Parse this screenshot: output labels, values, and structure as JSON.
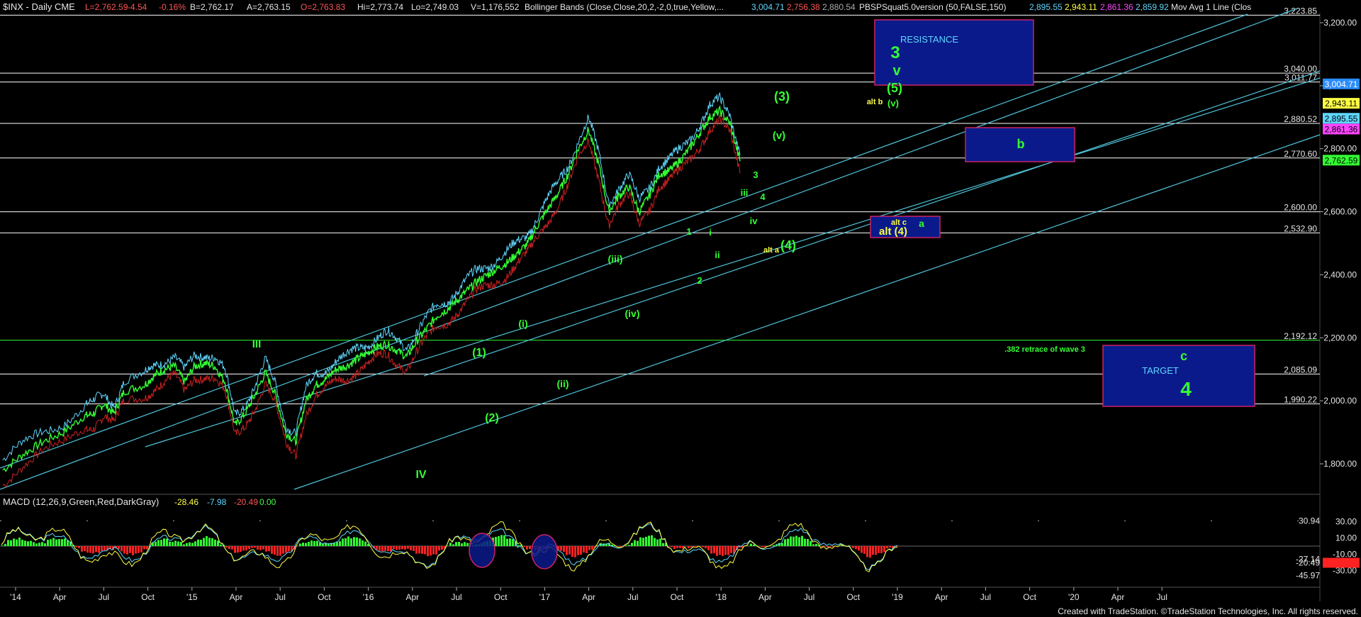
{
  "header": {
    "symbol": "$INX - Daily  CME",
    "fields": [
      {
        "text": "L=2,762.59",
        "color": "#ff5555"
      },
      {
        "text": "-4.54",
        "color": "#ff5555"
      },
      {
        "text": "-0.16%",
        "color": "#ff5555"
      },
      {
        "text": "B=2,762.17",
        "color": "#e6e6e6"
      },
      {
        "text": "A=2,763.15",
        "color": "#e6e6e6"
      },
      {
        "text": "O=2,763.83",
        "color": "#ff5555"
      },
      {
        "text": "Hi=2,773.74",
        "color": "#e6e6e6"
      },
      {
        "text": "Lo=2,749.03",
        "color": "#e6e6e6"
      },
      {
        "text": "V=1,176,552",
        "color": "#e6e6e6"
      },
      {
        "text": "Bollinger Bands (Close,Close,20,2,-2,0,true,Yellow,...",
        "color": "#e6e6e6"
      },
      {
        "text": "3,004.71",
        "color": "#5fd7ff"
      },
      {
        "text": "2,756.38",
        "color": "#ff5555"
      },
      {
        "text": "2,880.54",
        "color": "#aaaaaa"
      },
      {
        "text": "PBSPSquat5.0version (50,FALSE,150)",
        "color": "#e6e6e6"
      },
      {
        "text": "2,895.55",
        "color": "#5fd7ff"
      },
      {
        "text": "2,943.11",
        "color": "#ffff44"
      },
      {
        "text": "2,861.36",
        "color": "#ff44ff"
      },
      {
        "text": "2,859.92",
        "color": "#5fd7ff"
      },
      {
        "text": "Mov Avg 1 Line (Clos",
        "color": "#e6e6e6"
      }
    ]
  },
  "macd_header": {
    "label": "MACD (12,26,9,Green,Red,DarkGray)",
    "fields": [
      {
        "text": "-28.46",
        "color": "#ffff44"
      },
      {
        "text": "-7.98",
        "color": "#5fd7ff"
      },
      {
        "text": "-20.49",
        "color": "#ff5555"
      },
      {
        "text": "0.00",
        "color": "#44ff44"
      }
    ]
  },
  "footer": "Created with TradeStation. ©TradeStation Technologies, Inc. All rights reserved.",
  "colors": {
    "price": "#33ff33",
    "upper_band": "#5fd7ff",
    "lower_band": "#cc2222",
    "trend": "#4fc3d9",
    "box_fill": "#0a1a8a",
    "box_border": "#cc2266",
    "wave": "#33ff33",
    "alt": "#ffff44"
  },
  "chart_data": {
    "type": "line",
    "title": "$INX - Daily",
    "price_axis": {
      "min": 1650,
      "max": 3240,
      "ticks": [
        1800,
        2000,
        2200,
        2400,
        2600,
        2800,
        3000,
        3200
      ],
      "tick_labels": [
        "1,800.00",
        "2,000.00",
        "2,200.00",
        "2,400.00",
        "2,600.00",
        "2,800.00",
        "3,000.00",
        "3,200.00"
      ]
    },
    "x_axis": {
      "labels": [
        "'14",
        "Apr",
        "Jul",
        "Oct",
        "'15",
        "Apr",
        "Jul",
        "Oct",
        "'16",
        "Apr",
        "Jul",
        "Oct",
        "'17",
        "Apr",
        "Jul",
        "Oct",
        "'18",
        "Apr",
        "Jul",
        "Oct",
        "'19",
        "Apr",
        "Jul",
        "Oct",
        "'20",
        "Apr",
        "Jul"
      ]
    },
    "price_path": [
      [
        0,
        1780
      ],
      [
        2,
        1830
      ],
      [
        4,
        1870
      ],
      [
        6,
        1900
      ],
      [
        8,
        1950
      ],
      [
        9,
        1960
      ],
      [
        10,
        1990
      ],
      [
        11,
        1960
      ],
      [
        12,
        2030
      ],
      [
        14,
        2050
      ],
      [
        15,
        2080
      ],
      [
        16,
        2100
      ],
      [
        17,
        2110
      ],
      [
        18,
        2060
      ],
      [
        19,
        2110
      ],
      [
        20,
        2120
      ],
      [
        21,
        2110
      ],
      [
        22,
        2060
      ],
      [
        23,
        1920
      ],
      [
        24,
        1960
      ],
      [
        25,
        2020
      ],
      [
        26,
        2090
      ],
      [
        27,
        2020
      ],
      [
        28,
        1900
      ],
      [
        29,
        1870
      ],
      [
        30,
        2000
      ],
      [
        31,
        2050
      ],
      [
        32,
        2070
      ],
      [
        33,
        2100
      ],
      [
        34,
        2110
      ],
      [
        35,
        2130
      ],
      [
        36,
        2150
      ],
      [
        37,
        2170
      ],
      [
        38,
        2180
      ],
      [
        39,
        2160
      ],
      [
        40,
        2140
      ],
      [
        41,
        2190
      ],
      [
        42,
        2230
      ],
      [
        43,
        2270
      ],
      [
        44,
        2290
      ],
      [
        45,
        2320
      ],
      [
        46,
        2350
      ],
      [
        47,
        2380
      ],
      [
        48,
        2400
      ],
      [
        49,
        2420
      ],
      [
        50,
        2440
      ],
      [
        51,
        2470
      ],
      [
        52,
        2500
      ],
      [
        53,
        2560
      ],
      [
        54,
        2610
      ],
      [
        55,
        2660
      ],
      [
        56,
        2720
      ],
      [
        57,
        2800
      ],
      [
        58,
        2860
      ],
      [
        59,
        2750
      ],
      [
        60,
        2600
      ],
      [
        61,
        2650
      ],
      [
        62,
        2680
      ],
      [
        63,
        2600
      ],
      [
        64,
        2650
      ],
      [
        65,
        2720
      ],
      [
        66,
        2730
      ],
      [
        67,
        2760
      ],
      [
        68,
        2800
      ],
      [
        69,
        2850
      ],
      [
        70,
        2900
      ],
      [
        71,
        2920
      ],
      [
        72,
        2880
      ],
      [
        73,
        2760
      ]
    ],
    "price_path_note": "x in index units (0 = start of '14 = 19.5 per quarter column); y in index points",
    "horizontal_levels": [
      {
        "value": 3223.85,
        "label": "3,223.85",
        "color": "#ffffff"
      },
      {
        "value": 3040.0,
        "label": "3,040.00",
        "color": "#ffffff"
      },
      {
        "value": 3011.77,
        "label": "3,011.77",
        "color": "#ffffff"
      },
      {
        "value": 2880.52,
        "label": "2,880.52",
        "color": "#ffffff"
      },
      {
        "value": 2770.6,
        "label": "2,770.60",
        "color": "#ffffff"
      },
      {
        "value": 2600.0,
        "label": "2,600.00",
        "color": "#ffffff"
      },
      {
        "value": 2532.9,
        "label": "2,532.90",
        "color": "#ffffff"
      },
      {
        "value": 2192.12,
        "label": "2,192.12",
        "color": "#33ff33"
      },
      {
        "value": 2085.09,
        "label": "2,085.09",
        "color": "#ffffff"
      },
      {
        "value": 1990.22,
        "label": "1,990.22",
        "color": "#ffffff"
      }
    ],
    "right_badges": [
      {
        "value": 3004.71,
        "label": "3,004.71",
        "bg": "#2a8cff",
        "fg": "#ffffff"
      },
      {
        "value": 2943.11,
        "label": "2,943.11",
        "bg": "#ffff44",
        "fg": "#000000"
      },
      {
        "value": 2895.55,
        "label": "2,895.55",
        "bg": "#5fd7ff",
        "fg": "#000000"
      },
      {
        "value": 2861.36,
        "label": "2,861.36",
        "bg": "#ff44ff",
        "fg": "#000000"
      },
      {
        "value": 2762.59,
        "label": "2,762.59",
        "bg": "#33ff33",
        "fg": "#000000"
      }
    ],
    "macd_axis": {
      "ticks": [
        30,
        10,
        -10,
        -30
      ],
      "tick_labels": [
        "30.00",
        "10.00",
        "-10.00",
        "-30.00"
      ],
      "markers": [
        {
          "label": "30.94"
        },
        {
          "label": "-27.14"
        },
        {
          "label": "-20.49"
        },
        {
          "label": "-45.97"
        }
      ]
    },
    "annotations": {
      "boxes": [
        {
          "name": "resistance-box",
          "label": "RESISTANCE",
          "label_color": "#5fd7ff"
        },
        {
          "name": "b-box",
          "label": "b",
          "label_color": "#33ff33"
        },
        {
          "name": "a-box",
          "label": "a",
          "label_color": "#33ff33"
        },
        {
          "name": "target-box",
          "label": "TARGET",
          "label_color": "#5fd7ff"
        }
      ],
      "wave_labels": [
        {
          "text": "III",
          "color": "#33ff33"
        },
        {
          "text": "IV",
          "color": "#33ff33"
        },
        {
          "text": "(1)",
          "color": "#33ff33"
        },
        {
          "text": "(2)",
          "color": "#33ff33"
        },
        {
          "text": "(i)",
          "color": "#33ff33"
        },
        {
          "text": "(ii)",
          "color": "#33ff33"
        },
        {
          "text": "(iii)",
          "color": "#33ff33"
        },
        {
          "text": "(iv)",
          "color": "#33ff33"
        },
        {
          "text": "1",
          "color": "#33ff33"
        },
        {
          "text": "2",
          "color": "#33ff33"
        },
        {
          "text": "i",
          "color": "#33ff33"
        },
        {
          "text": "ii",
          "color": "#33ff33"
        },
        {
          "text": "iii",
          "color": "#33ff33"
        },
        {
          "text": "iv",
          "color": "#33ff33"
        },
        {
          "text": "3",
          "color": "#33ff33"
        },
        {
          "text": "4",
          "color": "#33ff33"
        },
        {
          "text": "(3)",
          "color": "#33ff33"
        },
        {
          "text": "(v)",
          "color": "#33ff33"
        },
        {
          "text": "(4)",
          "color": "#33ff33"
        },
        {
          "text": "alt a",
          "color": "#ffff44"
        },
        {
          "text": "alt b",
          "color": "#ffff44"
        },
        {
          "text": "alt c",
          "color": "#ffff44"
        },
        {
          "text": "alt (4)",
          "color": "#ffff44"
        },
        {
          "text": "(5)",
          "color": "#33ff33"
        },
        {
          "text": "(v)",
          "color": "#33ff33"
        },
        {
          "text": "3",
          "color": "#33ff33"
        },
        {
          "text": "v",
          "color": "#33ff33"
        },
        {
          "text": "c",
          "color": "#33ff33"
        },
        {
          "text": "4",
          "color": "#33ff33"
        },
        {
          "text": ".382 retrace of wave 3",
          "color": "#33ff33"
        }
      ]
    }
  }
}
